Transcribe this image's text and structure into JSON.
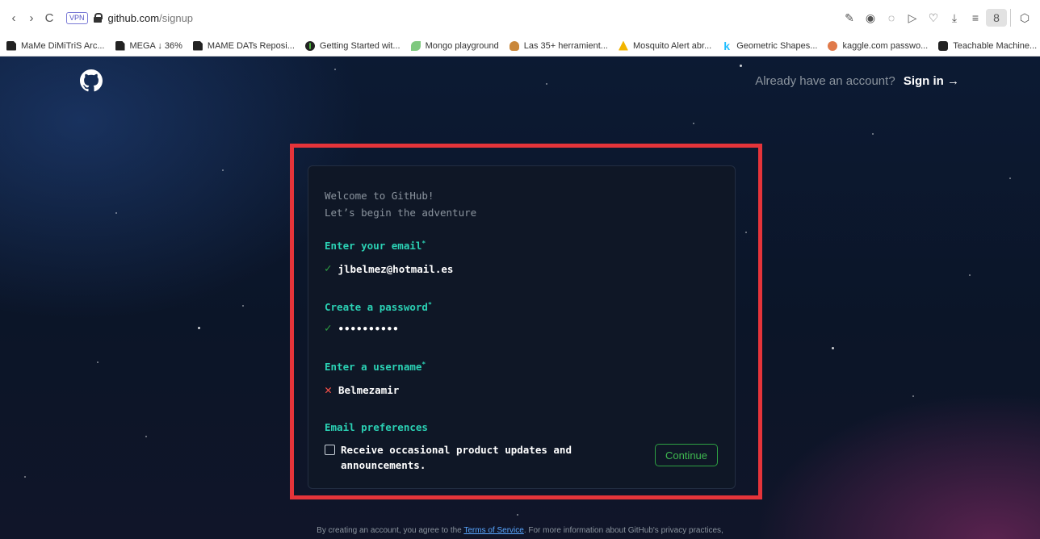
{
  "browser": {
    "url_host": "github.com",
    "url_path": "/signup",
    "vpn_label": "VPN",
    "nav": {
      "back": "‹",
      "forward": "›",
      "reload": "C"
    },
    "toolbar_icons": [
      "edit-icon",
      "camera-icon",
      "shield-icon",
      "play-icon",
      "heart-icon",
      "download-icon",
      "menu-icon",
      "profile-icon",
      "extensions-icon"
    ]
  },
  "bookmarks": [
    {
      "label": "MaMe DiMiTriS Arc...",
      "icon": "doc"
    },
    {
      "label": "MEGA ↓ 36%",
      "icon": "doc"
    },
    {
      "label": "MAME DATs Reposi...",
      "icon": "doc"
    },
    {
      "label": "Getting Started wit...",
      "icon": "mongo"
    },
    {
      "label": "Mongo playground",
      "icon": "leaf"
    },
    {
      "label": "Las 35+ herramient...",
      "icon": "fox"
    },
    {
      "label": "Mosquito Alert abr...",
      "icon": "mosq"
    },
    {
      "label": "Geometric Shapes...",
      "icon": "kag"
    },
    {
      "label": "kaggle.com passwo...",
      "icon": "bug"
    },
    {
      "label": "Teachable Machine...",
      "icon": "tm"
    }
  ],
  "header": {
    "already_text": "Already have an account?",
    "signin_label": "Sign in →"
  },
  "form": {
    "welcome_line1": "Welcome to GitHub!",
    "welcome_line2": "Let’s begin the adventure",
    "email_label": "Enter your email",
    "email_value": "jlbelmez@hotmail.es",
    "password_label": "Create a password",
    "password_value": "••••••••••",
    "username_label": "Enter a username",
    "username_value": "Belmezamir",
    "required_mark": "*",
    "check_mark": "✓",
    "cross_mark": "✕",
    "prefs_label": "Email preferences",
    "prefs_checkbox_text": "Receive occasional product updates and announcements.",
    "continue_label": "Continue"
  },
  "footer": {
    "prefix": "By creating an account, you agree to the ",
    "terms_link": "Terms of Service",
    "suffix": ". For more information about GitHub's privacy practices,"
  },
  "colors": {
    "accent_teal": "#2bd1b4",
    "success_green": "#2ea043",
    "error_red": "#f85149",
    "highlight_red": "#e5343a"
  }
}
